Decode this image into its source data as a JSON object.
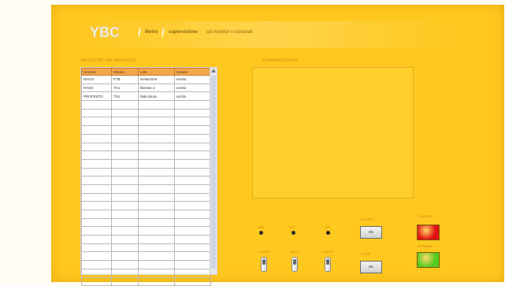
{
  "header": {
    "logo_text": "YBC",
    "crumb1": "Metro",
    "crumb2": "supervisione",
    "crumb2_tail": "sul monitor e comandi"
  },
  "register": {
    "title": "REGISTRO DEI PASSAGGI",
    "columns": [
      "Nombre",
      "Estado",
      "Lote",
      "Estado"
    ],
    "rows": [
      [
        "RAGO",
        "FTB",
        "invitazione",
        "annito"
      ],
      [
        "RASS",
        "TS1",
        "liberato a",
        "annito"
      ],
      [
        "PROFESTO",
        "TS1",
        "fatticnitura",
        "annito"
      ]
    ],
    "empty_rows": 22
  },
  "comm": {
    "title": "COMUNICAZIONI"
  },
  "controls": {
    "leds": [
      {
        "label": "SM"
      },
      {
        "label": "AR"
      },
      {
        "label": "CR"
      }
    ],
    "toggles": [
      {
        "label": "AUTO"
      },
      {
        "label": "AUTO"
      },
      {
        "label": "AUTO"
      }
    ],
    "buttons": [
      {
        "top_label": "AVANTI",
        "label": "OK"
      },
      {
        "top_label": "STOP",
        "label": "OK"
      }
    ],
    "lamps": [
      {
        "label": "ALLARM",
        "color": "#e01010"
      },
      {
        "label": "NORMAL",
        "color": "#55cc22"
      }
    ]
  },
  "colors": {
    "panel": "#ffc81f",
    "table_header": "#f4a64a"
  }
}
